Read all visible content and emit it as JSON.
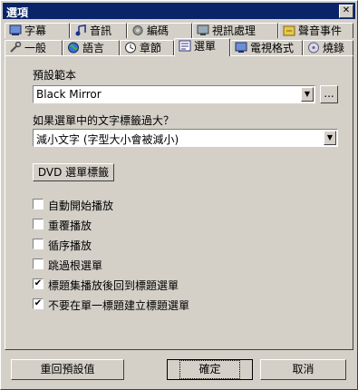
{
  "window": {
    "title": "選項",
    "close_glyph": "✕"
  },
  "tabs_row1": [
    {
      "label": "字幕",
      "icon": "subtitles-icon"
    },
    {
      "label": "音訊",
      "icon": "audio-icon"
    },
    {
      "label": "編碼",
      "icon": "encoding-icon"
    },
    {
      "label": "視訊處理",
      "icon": "video-processing-icon"
    },
    {
      "label": "聲音事件",
      "icon": "sound-events-icon"
    }
  ],
  "tabs_row2": [
    {
      "label": "一般",
      "icon": "general-icon"
    },
    {
      "label": "語言",
      "icon": "language-icon"
    },
    {
      "label": "章節",
      "icon": "chapters-icon"
    },
    {
      "label": "選單",
      "icon": "menu-icon",
      "active": true
    },
    {
      "label": "電視格式",
      "icon": "tv-format-icon"
    },
    {
      "label": "燒錄",
      "icon": "burn-icon"
    }
  ],
  "menu_panel": {
    "preset_label": "預設範本",
    "preset_value": "Black Mirror",
    "browse_label": "...",
    "overflow_label": "如果選單中的文字標籤過大？",
    "overflow_value": "減小文字 (字型大小會被減小)",
    "dvd_labels_button": "DVD 選單標籤",
    "checkboxes": [
      {
        "label": "自動開始播放",
        "checked": false
      },
      {
        "label": "重覆播放",
        "checked": false
      },
      {
        "label": "循序播放",
        "checked": false
      },
      {
        "label": "跳過根選單",
        "checked": false
      },
      {
        "label": "標題集播放後回到標題選單",
        "checked": true
      },
      {
        "label": "不要在單一標題建立標題選單",
        "checked": true
      }
    ]
  },
  "footer": {
    "reset_label": "重回預設值",
    "ok_label": "確定",
    "cancel_label": "取消"
  }
}
